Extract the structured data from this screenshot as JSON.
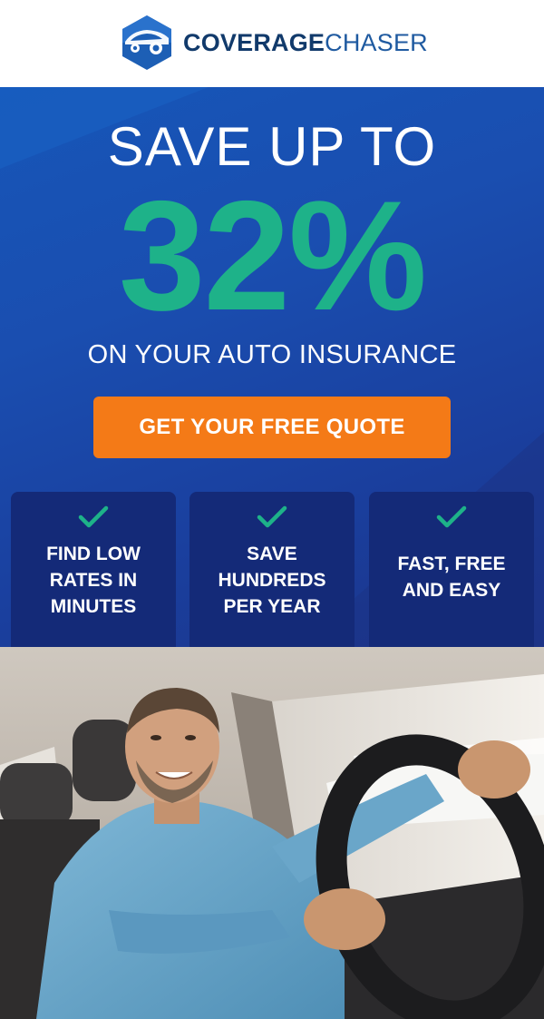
{
  "brand": {
    "name_bold": "COVERAGE",
    "name_light": "CHASER"
  },
  "hero": {
    "headline": "SAVE UP TO",
    "percent": "32%",
    "subline": "ON YOUR AUTO INSURANCE",
    "cta_label": "GET YOUR FREE QUOTE"
  },
  "features": [
    {
      "lines": [
        "FIND LOW",
        "RATES IN",
        "MINUTES"
      ]
    },
    {
      "lines": [
        "SAVE",
        "HUNDREDS",
        "PER YEAR"
      ]
    },
    {
      "lines": [
        "FAST, FREE",
        "AND EASY"
      ]
    }
  ],
  "colors": {
    "hero_blue": "#1a4eb0",
    "accent_green": "#1eb289",
    "cta_orange": "#f47a17",
    "feature_navy": "#142a78",
    "brand_navy": "#113a6b"
  },
  "icons": {
    "logo": "car-hexagon-icon",
    "feature": "checkmark-icon"
  }
}
